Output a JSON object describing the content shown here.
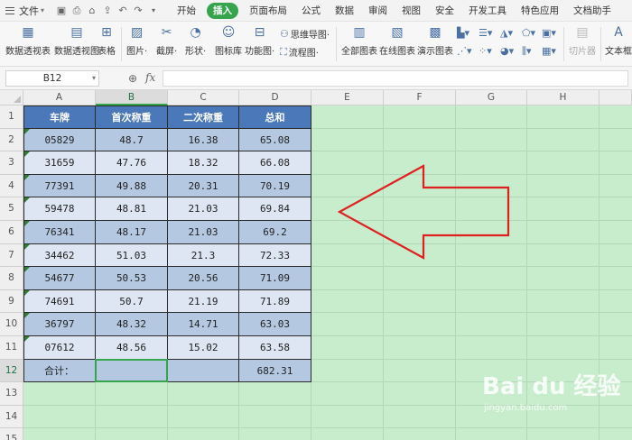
{
  "menubar": {
    "file": "文件",
    "qat_icons": [
      "save-icon",
      "print-icon",
      "format-painter-icon",
      "export-icon",
      "undo-icon",
      "redo-icon",
      "dropdown-icon"
    ],
    "tabs": [
      "开始",
      "插入",
      "页面布局",
      "公式",
      "数据",
      "审阅",
      "视图",
      "安全",
      "开发工具",
      "特色应用",
      "文档助手"
    ],
    "active_tab": "插入"
  },
  "ribbon": {
    "buttons": [
      {
        "label": "数据透视表",
        "icon": "pivot-table-icon"
      },
      {
        "label": "数据透视图",
        "icon": "pivot-chart-icon"
      },
      {
        "label": "表格",
        "icon": "table-icon"
      },
      {
        "label": "图片·",
        "icon": "picture-icon"
      },
      {
        "label": "截屏·",
        "icon": "screenshot-icon"
      },
      {
        "label": "形状·",
        "icon": "shapes-icon"
      },
      {
        "label": "图标库",
        "icon": "icon-library-icon"
      },
      {
        "label": "功能图·",
        "icon": "function-chart-icon"
      },
      {
        "label": "全部图表",
        "icon": "all-charts-icon"
      },
      {
        "label": "在线图表",
        "icon": "online-charts-icon"
      },
      {
        "label": "演示图表",
        "icon": "demo-charts-icon"
      },
      {
        "label": "切片器",
        "icon": "slicer-icon"
      },
      {
        "label": "文本框",
        "icon": "textbox-icon"
      }
    ],
    "mindmap": "思维导图·",
    "flowchart": "流程图·"
  },
  "formula_bar": {
    "name_box": "B12",
    "fx": "fx",
    "value": ""
  },
  "grid": {
    "columns": [
      "A",
      "B",
      "C",
      "D",
      "E",
      "F",
      "G",
      "H"
    ],
    "rows": [
      "1",
      "2",
      "3",
      "4",
      "5",
      "6",
      "7",
      "8",
      "9",
      "10",
      "11",
      "12",
      "13",
      "14",
      "15"
    ],
    "selected_cell": "B12",
    "table": {
      "headers": [
        "车牌",
        "首次称重",
        "二次称重",
        "总和"
      ],
      "rows": [
        [
          "05829",
          "48.7",
          "16.38",
          "65.08"
        ],
        [
          "31659",
          "47.76",
          "18.32",
          "66.08"
        ],
        [
          "77391",
          "49.88",
          "20.31",
          "70.19"
        ],
        [
          "59478",
          "48.81",
          "21.03",
          "69.84"
        ],
        [
          "76341",
          "48.17",
          "21.03",
          "69.2"
        ],
        [
          "34462",
          "51.03",
          "21.3",
          "72.33"
        ],
        [
          "54677",
          "50.53",
          "20.56",
          "71.09"
        ],
        [
          "74691",
          "50.7",
          "21.19",
          "71.89"
        ],
        [
          "36797",
          "48.32",
          "14.71",
          "63.03"
        ],
        [
          "07612",
          "48.56",
          "15.02",
          "63.58"
        ]
      ],
      "total_row": [
        "合计：",
        "",
        "",
        "682.31"
      ]
    }
  },
  "annotation": {
    "arrow_color": "#e02020",
    "direction": "left"
  },
  "watermark": {
    "logo": "Bai du 经验",
    "url": "jingyan.baidu.com"
  },
  "colors": {
    "header_fill": "#4a78b8",
    "row_dark": "#b5c8e2",
    "row_light": "#dde6f2",
    "sheet_bg": "#c7edcc",
    "accent": "#35a44c"
  }
}
